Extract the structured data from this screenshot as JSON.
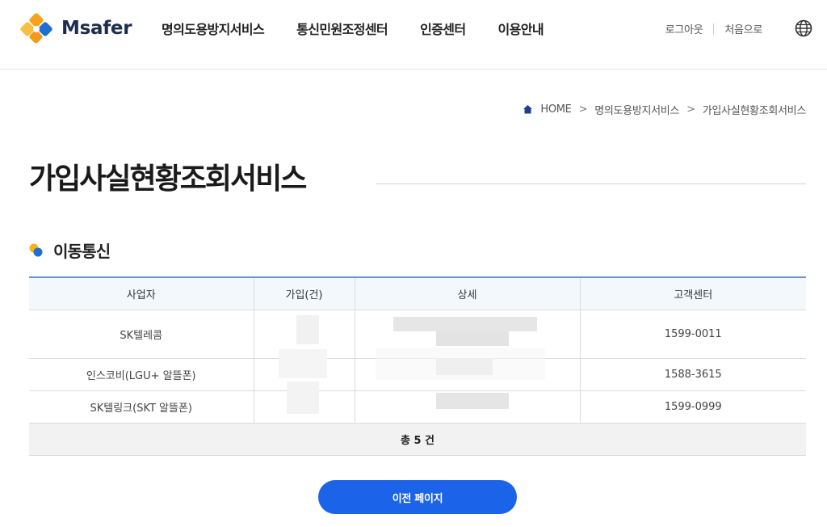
{
  "header": {
    "logo_text": "Msafer",
    "nav": [
      "명의도용방지서비스",
      "통신민원조정센터",
      "인증센터",
      "이용안내"
    ],
    "util": {
      "logout": "로그아웃",
      "home": "처음으로"
    }
  },
  "breadcrumb": [
    "HOME",
    "명의도용방지서비스",
    "가입사실현황조회서비스"
  ],
  "page_title": "가입사실현황조회서비스",
  "section": {
    "title": "이동통신",
    "table": {
      "headers": [
        "사업자",
        "가입(건)",
        "상세",
        "고객센터"
      ],
      "rows": [
        {
          "carrier": "SK텔레콤",
          "count": "",
          "detail": "",
          "contact": "1599-0011"
        },
        {
          "carrier": "인스코비(LGU+ 알뜰폰)",
          "count": "",
          "detail": "",
          "contact": "1588-3615"
        },
        {
          "carrier": "SK텔링크(SKT 알뜰폰)",
          "count": "",
          "detail": "",
          "contact": "1599-0999"
        }
      ],
      "total": "총 5 건"
    }
  },
  "buttons": {
    "prev": "이전 페이지"
  },
  "colors": {
    "primary": "#1b63e8",
    "logo_orange": "#f7a21b",
    "logo_blue": "#1d6fd1",
    "table_border": "#6d94c7"
  }
}
